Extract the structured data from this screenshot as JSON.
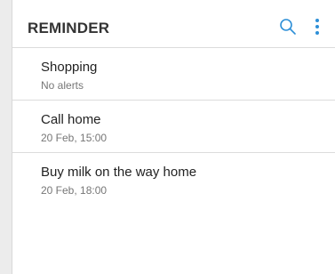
{
  "header": {
    "title": "REMINDER",
    "accent_color": "#2d8fd7",
    "search_icon": "search-icon",
    "more_icon": "more-vert-icon"
  },
  "reminders": [
    {
      "title": "Shopping",
      "subtitle": "No alerts"
    },
    {
      "title": "Call home",
      "subtitle": "20 Feb, 15:00"
    },
    {
      "title": "Buy milk on the way home",
      "subtitle": "20 Feb, 18:00"
    }
  ]
}
